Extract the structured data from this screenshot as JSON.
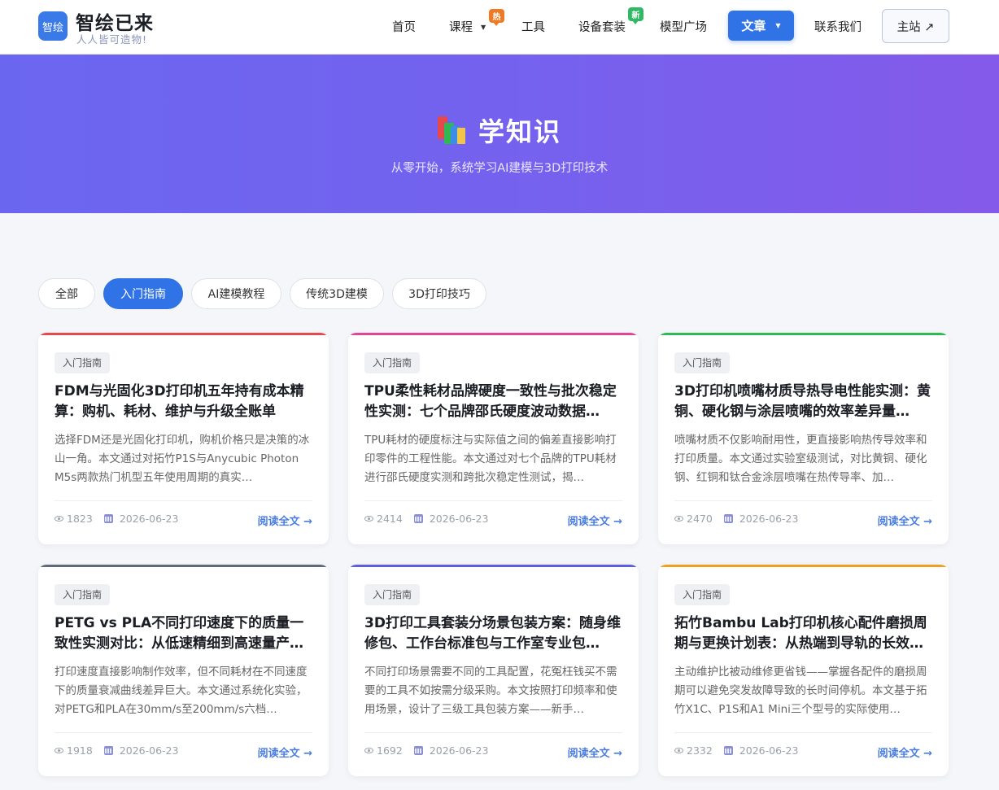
{
  "header": {
    "logo_text": "智绘",
    "brand_name": "智绘已来",
    "slogan": "人人皆可造物!",
    "nav": {
      "home": "首页",
      "courses": "课程",
      "courses_badge": "热",
      "tools": "工具",
      "device_kits": "设备套装",
      "device_kits_badge": "新",
      "model_square": "模型广场",
      "articles": "文章",
      "contact": "联系我们",
      "main_site": "主站 ↗"
    }
  },
  "hero": {
    "title": "学知识",
    "subtitle": "从零开始，系统学习AI建模与3D打印技术"
  },
  "filters": [
    "全部",
    "入门指南",
    "AI建模教程",
    "传统3D建模",
    "3D打印技巧"
  ],
  "active_filter": "入门指南",
  "read_more_label": "阅读全文 →",
  "cards": [
    {
      "tag": "入门指南",
      "title": "FDM与光固化3D打印机五年持有成本精算：购机、耗材、维护与升级全账单",
      "desc": "选择FDM还是光固化打印机，购机价格只是决策的冰山一角。本文通过对拓竹P1S与Anycubic Photon M5s两款热门机型五年使用周期的真实…",
      "views": "1823",
      "date": "2026-06-23",
      "accent": "#e5484d"
    },
    {
      "tag": "入门指南",
      "title": "TPU柔性耗材品牌硬度一致性与批次稳定性实测：七个品牌邵氏硬度波动数据…",
      "desc": "TPU耗材的硬度标注与实际值之间的偏差直接影响打印零件的工程性能。本文通过对七个品牌的TPU耗材进行邵氏硬度实测和跨批次稳定性测试，揭…",
      "views": "2414",
      "date": "2026-06-23",
      "accent": "#e04596"
    },
    {
      "tag": "入门指南",
      "title": "3D打印机喷嘴材质导热导电性能实测：黄铜、硬化钢与涂层喷嘴的效率差异量…",
      "desc": "喷嘴材质不仅影响耐用性，更直接影响热传导效率和打印质量。本文通过实验室级测试，对比黄铜、硬化钢、红铜和钛合金涂层喷嘴在热传导率、加…",
      "views": "2470",
      "date": "2026-06-23",
      "accent": "#2fb955"
    },
    {
      "tag": "入门指南",
      "title": "PETG vs PLA不同打印速度下的质量一致性实测对比：从低速精细到高速量产的…",
      "desc": "打印速度直接影响制作效率，但不同耗材在不同速度下的质量衰减曲线差异巨大。本文通过系统化实验，对PETG和PLA在30mm/s至200mm/s六档…",
      "views": "1918",
      "date": "2026-06-23",
      "accent": "#5c6a7a"
    },
    {
      "tag": "入门指南",
      "title": "3D打印工具套装分场景包装方案：随身维修包、工作台标准包与工作室专业包…",
      "desc": "不同打印场景需要不同的工具配置，花冤枉钱买不需要的工具不如按需分级采购。本文按照打印频率和使用场景，设计了三级工具包装方案——新手…",
      "views": "1692",
      "date": "2026-06-23",
      "accent": "#5b5fe0"
    },
    {
      "tag": "入门指南",
      "title": "拓竹Bambu Lab打印机核心配件磨损周期与更换计划表：从热端到导轨的长效…",
      "desc": "主动维护比被动维修更省钱——掌握各配件的磨损周期可以避免突发故障导致的长时间停机。本文基于拓竹X1C、P1S和A1 Mini三个型号的实际使用…",
      "views": "2332",
      "date": "2026-06-23",
      "accent": "#f0a020"
    }
  ]
}
